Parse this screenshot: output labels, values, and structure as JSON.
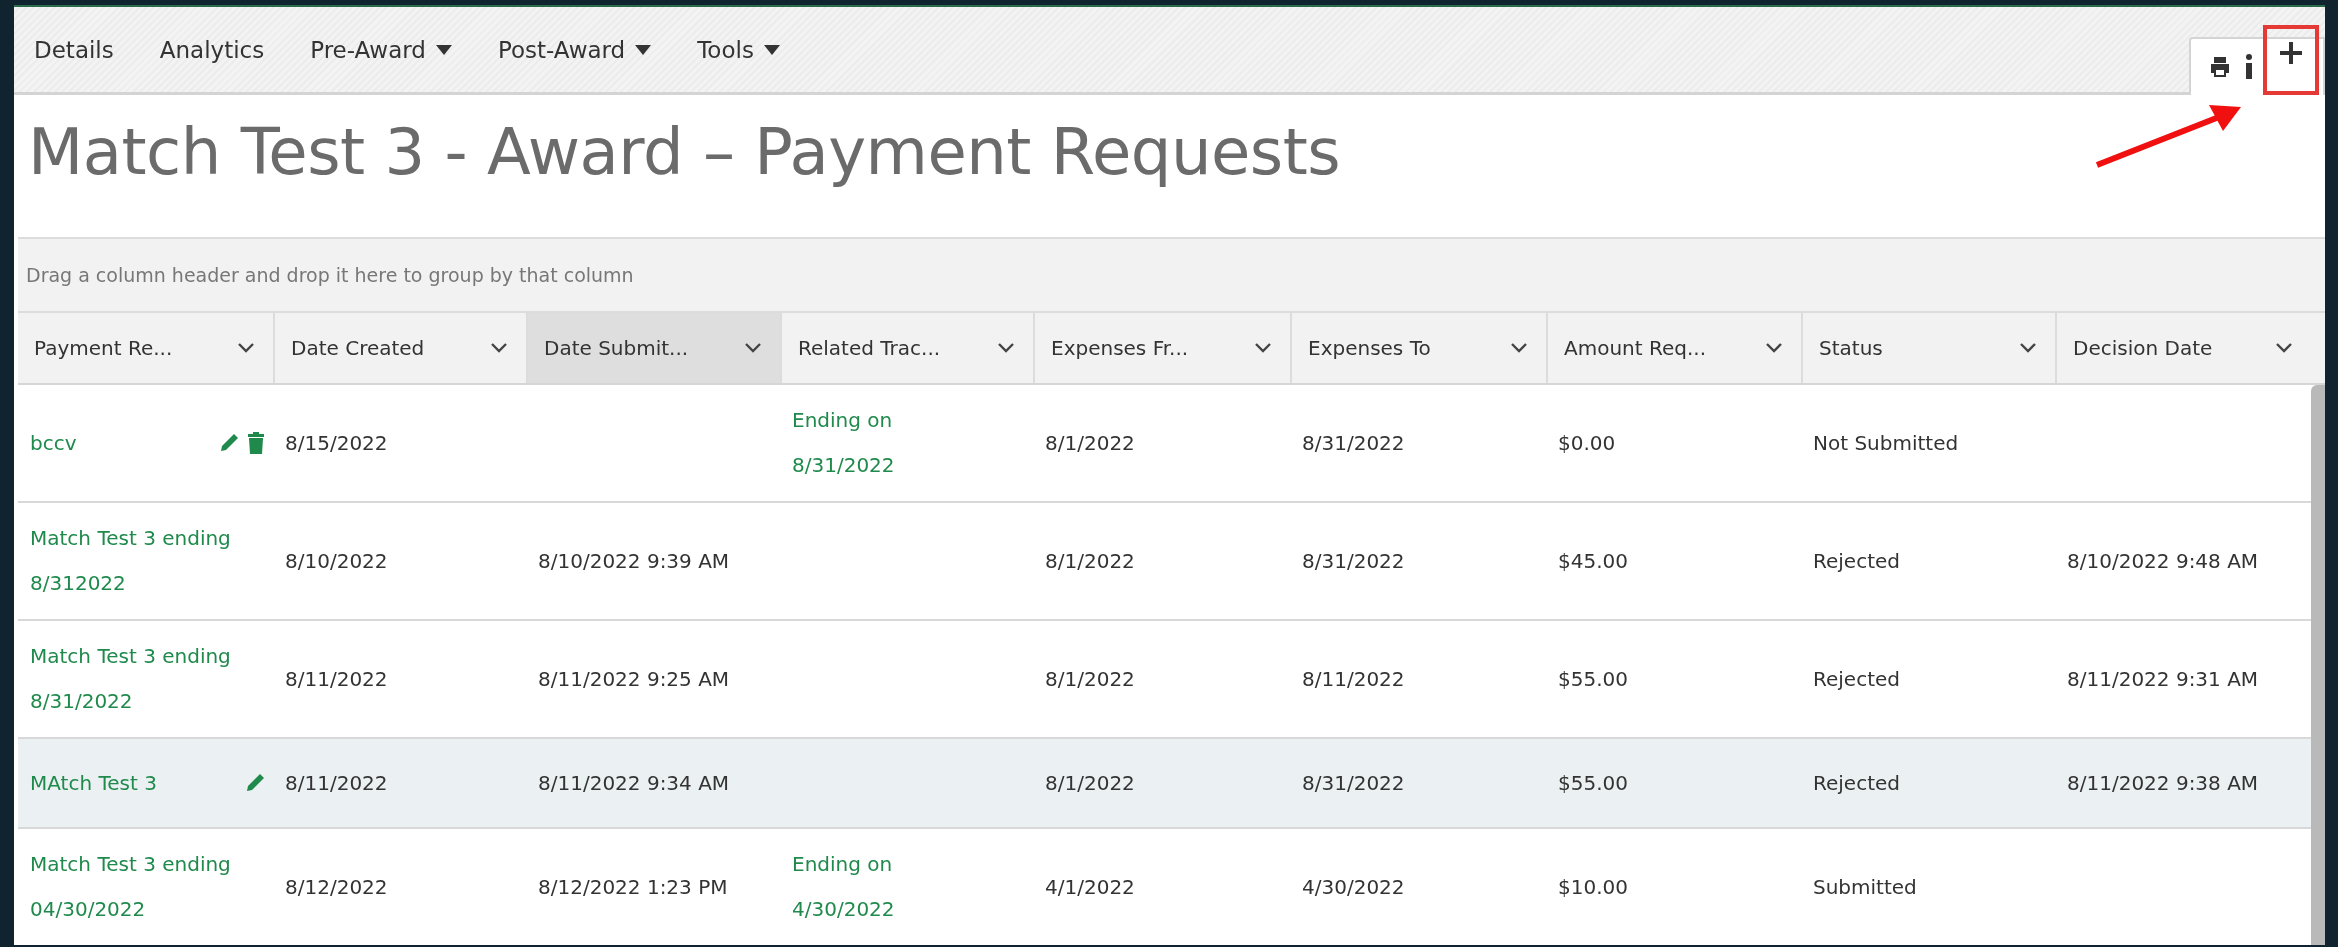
{
  "nav": [
    {
      "label": "Details",
      "dropdown": false
    },
    {
      "label": "Analytics",
      "dropdown": false
    },
    {
      "label": "Pre-Award",
      "dropdown": true
    },
    {
      "label": "Post-Award",
      "dropdown": true
    },
    {
      "label": "Tools",
      "dropdown": true
    }
  ],
  "toolbar": [
    {
      "kind": "print",
      "highlighted": false
    },
    {
      "kind": "info",
      "highlighted": false
    },
    {
      "kind": "add",
      "highlighted": true
    }
  ],
  "title": "Match Test 3 - Award – Payment Requests",
  "group_hint": "Drag a column header and drop it here to group by that column",
  "table": {
    "columns": [
      {
        "label": "Payment Re...",
        "active": false
      },
      {
        "label": "Date Created",
        "active": false
      },
      {
        "label": "Date Submit...",
        "active": true
      },
      {
        "label": "Related Trac...",
        "active": false
      },
      {
        "label": "Expenses Fr...",
        "active": false
      },
      {
        "label": "Expenses To",
        "active": false
      },
      {
        "label": "Amount Req...",
        "active": false
      },
      {
        "label": "Status",
        "active": false
      },
      {
        "label": "Decision Date",
        "active": false
      }
    ],
    "rows": [
      {
        "selected": false,
        "name": "bccv",
        "editable": true,
        "deletable": true,
        "created": "8/15/2022",
        "submitted": "",
        "related": "Ending on 8/31/2022",
        "from": "8/1/2022",
        "to": "8/31/2022",
        "amount": "$0.00",
        "status": "Not Submitted",
        "decision": ""
      },
      {
        "selected": false,
        "name": "Match Test 3 ending 8/312022",
        "editable": false,
        "deletable": false,
        "created": "8/10/2022",
        "submitted": "8/10/2022 9:39 AM",
        "related": "",
        "from": "8/1/2022",
        "to": "8/31/2022",
        "amount": "$45.00",
        "status": "Rejected",
        "decision": "8/10/2022 9:48 AM"
      },
      {
        "selected": false,
        "name": "Match Test 3 ending 8/31/2022",
        "editable": false,
        "deletable": false,
        "created": "8/11/2022",
        "submitted": "8/11/2022 9:25 AM",
        "related": "",
        "from": "8/1/2022",
        "to": "8/11/2022",
        "amount": "$55.00",
        "status": "Rejected",
        "decision": "8/11/2022 9:31 AM"
      },
      {
        "selected": true,
        "name": "MAtch Test 3",
        "editable": true,
        "deletable": false,
        "created": "8/11/2022",
        "submitted": "8/11/2022 9:34 AM",
        "related": "",
        "from": "8/1/2022",
        "to": "8/31/2022",
        "amount": "$55.00",
        "status": "Rejected",
        "decision": "8/11/2022 9:38 AM"
      },
      {
        "selected": false,
        "name": "Match Test 3 ending 04/30/2022",
        "editable": false,
        "deletable": false,
        "created": "8/12/2022",
        "submitted": "8/12/2022 1:23 PM",
        "related": "Ending on 4/30/2022",
        "from": "4/1/2022",
        "to": "4/30/2022",
        "amount": "$10.00",
        "status": "Submitted",
        "decision": ""
      }
    ]
  }
}
